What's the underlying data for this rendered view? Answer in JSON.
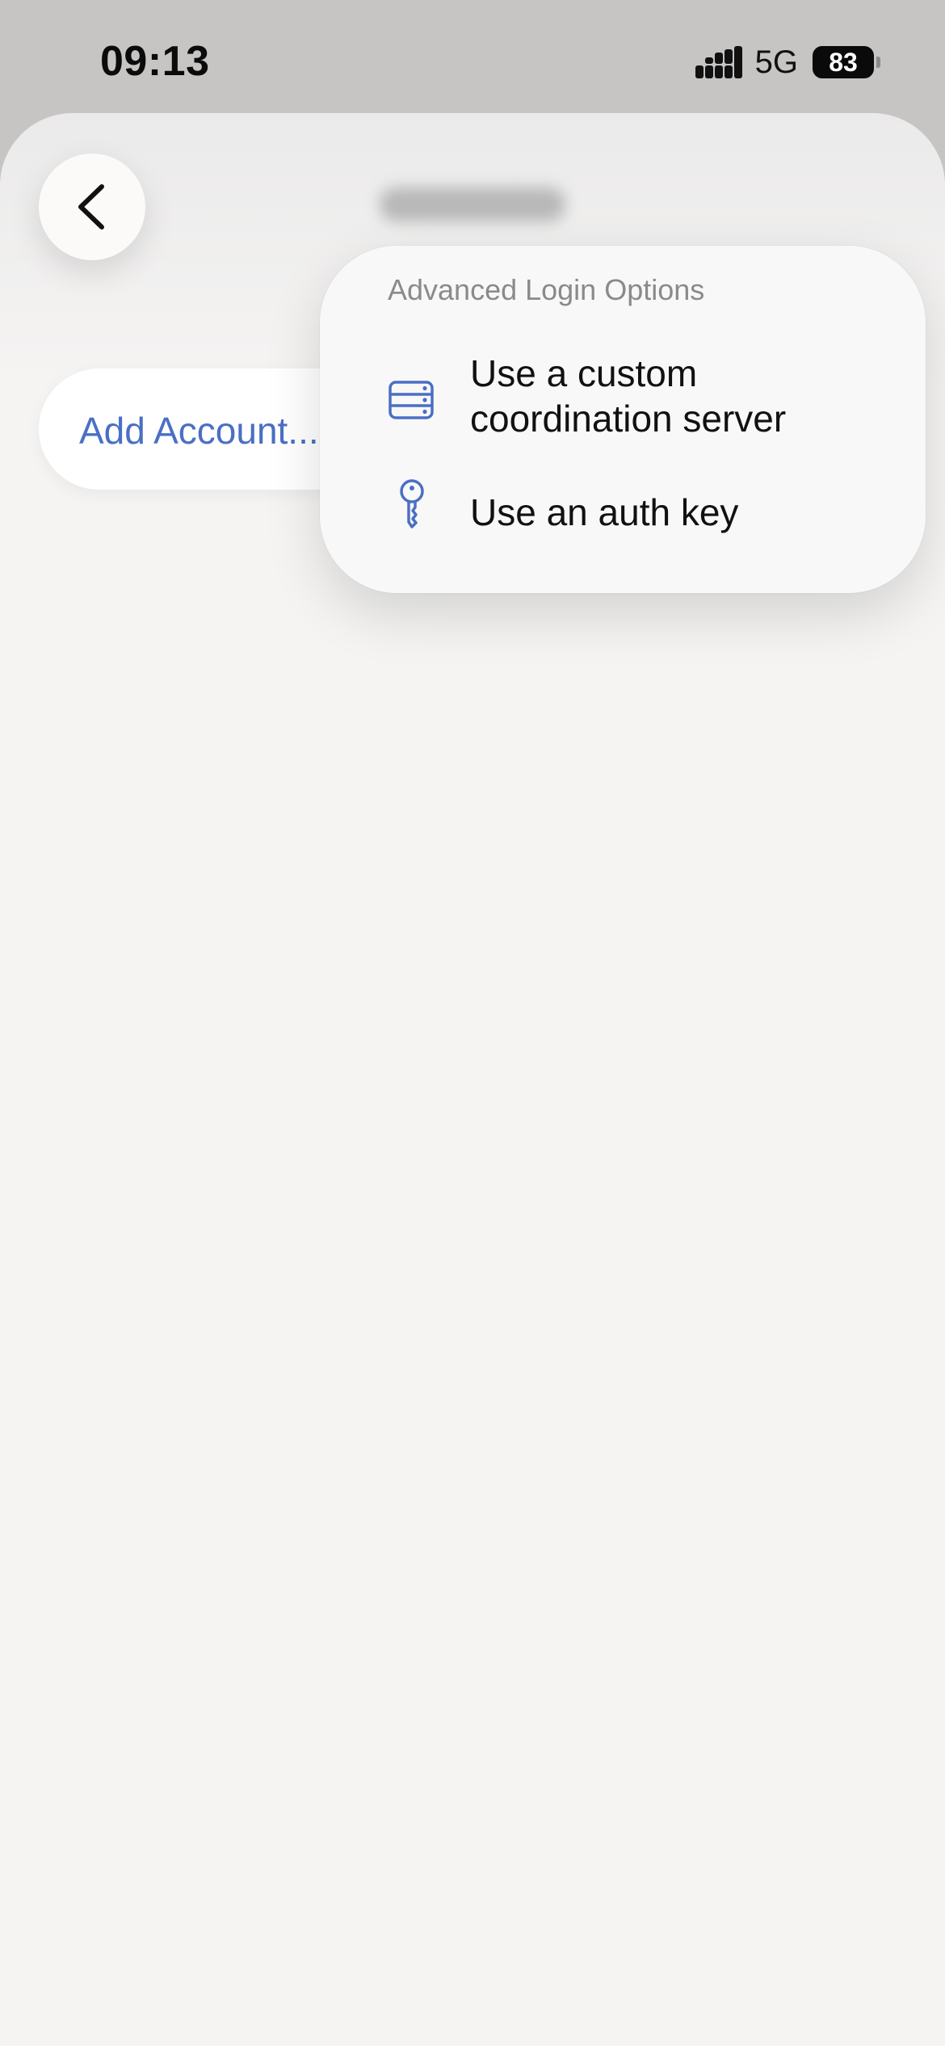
{
  "status_bar": {
    "time": "09:13",
    "network": "5G",
    "battery": "83",
    "icons": [
      "signal-icon",
      "battery-icon"
    ]
  },
  "navigation": {
    "back_icon": "chevron-left-icon"
  },
  "account": {
    "add_label": "Add Account..."
  },
  "popover": {
    "title": "Advanced Login Options",
    "items": [
      {
        "label": "Use a custom coordination server",
        "icon": "server-icon"
      },
      {
        "label": "Use an auth key",
        "icon": "key-icon"
      }
    ]
  },
  "colors": {
    "accent": "#4a6fc4",
    "background": "#f5f4f3",
    "status_background": "#c6c5c4"
  }
}
